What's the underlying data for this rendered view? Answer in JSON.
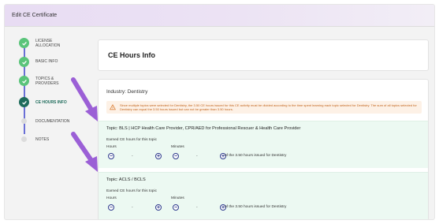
{
  "header": {
    "title": "Edit CE Certificate"
  },
  "stepper": {
    "steps": [
      {
        "label_line1": "LICENSE",
        "label_line2": "ALLOCATION",
        "state": "done"
      },
      {
        "label_line1": "BASIC INFO",
        "label_line2": "",
        "state": "done"
      },
      {
        "label_line1": "TOPICS &",
        "label_line2": "PROVIDERS",
        "state": "done"
      },
      {
        "label_line1": "CE HOURS INFO",
        "label_line2": "",
        "state": "current"
      },
      {
        "label_line1": "DOCUMENTATION",
        "label_line2": "",
        "state": "pending"
      },
      {
        "label_line1": "NOTES",
        "label_line2": "",
        "state": "pending"
      }
    ]
  },
  "page": {
    "title": "CE Hours Info"
  },
  "industry": {
    "label": "Industry: Dentistry",
    "warning": "Since multiple topics were selected for Dentistry, the 3.50 CE hours issued for this CE activity must be divided according to the time spent learning each topic selected for Dentistry. The sum of all topics selected for Dentistry can equal the 3.50 hours issued but can not be greater than 3.50 hours."
  },
  "topics": [
    {
      "title": "Topic: BLS | HCP Health Care Provider, CPR/AED for Professional Rescuer & Health Care Provider",
      "earned_label": "Earned CE hours for this topic",
      "hours_label": "Hours",
      "minutes_label": "Minutes",
      "hours_value": "-",
      "minutes_value": "-",
      "suffix": "of the 3.50 hours issued for Dentistry"
    },
    {
      "title": "Topic: ACLS / BCLS",
      "earned_label": "Earned CE hours for this topic",
      "hours_label": "Hours",
      "minutes_label": "Minutes",
      "hours_value": "-",
      "minutes_value": "-",
      "suffix": "of the 3.50 hours issued for Dentistry"
    }
  ],
  "colors": {
    "accent": "#1e6b5b",
    "done": "#5ac47a",
    "arrow": "#9b5fd6",
    "topic_bg": "#ecf9f2",
    "warning_text": "#c2651d"
  }
}
